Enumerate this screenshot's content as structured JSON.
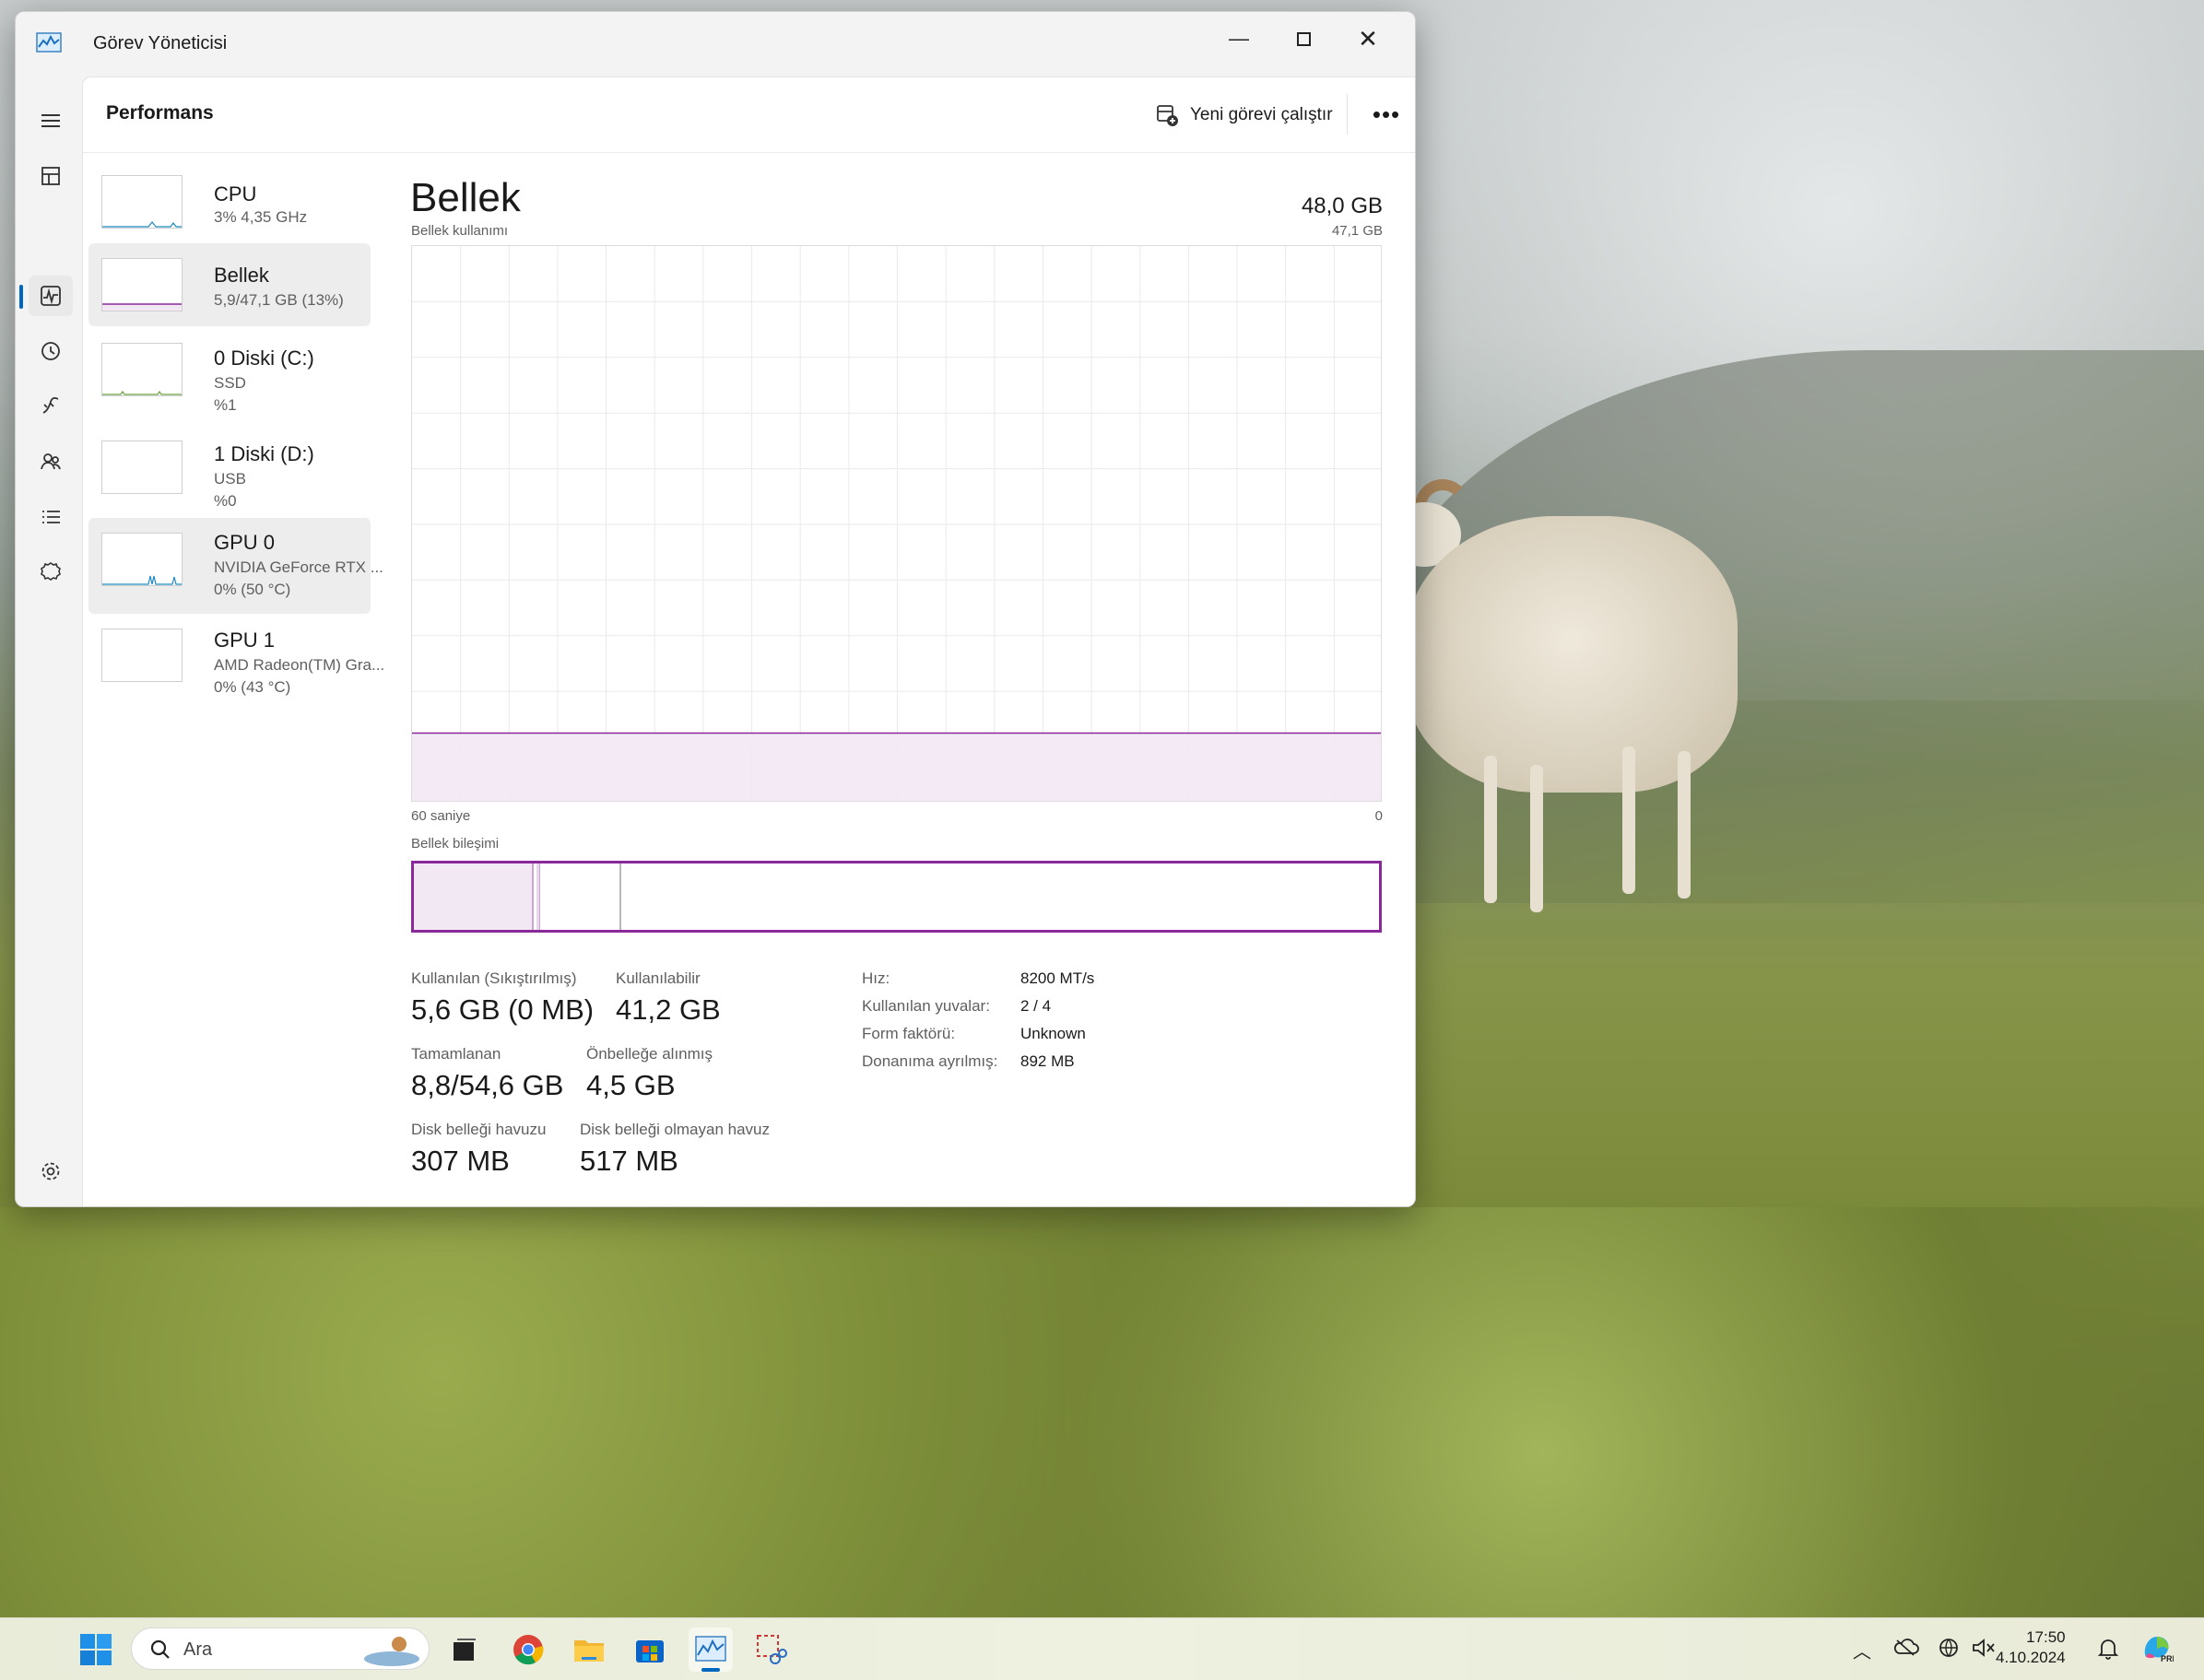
{
  "window": {
    "title": "Görev Yöneticisi"
  },
  "header": {
    "title": "Performans",
    "new_task": "Yeni görevi çalıştır"
  },
  "nav": [
    {
      "name": "menu-icon"
    },
    {
      "name": "processes-icon"
    },
    {
      "name": "performance-icon"
    },
    {
      "name": "app-history-icon"
    },
    {
      "name": "startup-apps-icon"
    },
    {
      "name": "users-icon"
    },
    {
      "name": "details-icon"
    },
    {
      "name": "services-icon"
    },
    {
      "name": "settings-icon"
    }
  ],
  "resources": [
    {
      "name": "CPU",
      "sub1": "3%  4,35 GHz",
      "sub2": ""
    },
    {
      "name": "Bellek",
      "sub1": "5,9/47,1 GB (13%)",
      "sub2": ""
    },
    {
      "name": "0 Diski (C:)",
      "sub1": "SSD",
      "sub2": "%1"
    },
    {
      "name": "1 Diski (D:)",
      "sub1": "USB",
      "sub2": "%0"
    },
    {
      "name": "GPU 0",
      "sub1": "NVIDIA GeForce RTX ...",
      "sub2": "0% (50 °C)"
    },
    {
      "name": "GPU 1",
      "sub1": "AMD Radeon(TM) Gra...",
      "sub2": "0% (43 °C)"
    }
  ],
  "memory": {
    "title": "Bellek",
    "total": "48,0 GB",
    "usage_label": "Bellek kullanımı",
    "max_label": "47,1 GB",
    "time_left": "60 saniye",
    "time_right": "0",
    "usage_fraction": 0.125,
    "composition_label": "Bellek bileşimi",
    "stats": {
      "used_label": "Kullanılan (Sıkıştırılmış)",
      "used_value": "5,6 GB (0 MB)",
      "avail_label": "Kullanılabilir",
      "avail_value": "41,2 GB",
      "committed_label": "Tamamlanan",
      "committed_value": "8,8/54,6 GB",
      "cached_label": "Önbelleğe alınmış",
      "cached_value": "4,5 GB",
      "paged_label": "Disk belleği havuzu",
      "paged_value": "307 MB",
      "nonpaged_label": "Disk belleği olmayan havuz",
      "nonpaged_value": "517 MB"
    },
    "details": [
      {
        "label": "Hız:",
        "value": "8200 MT/s"
      },
      {
        "label": "Kullanılan yuvalar:",
        "value": "2 / 4"
      },
      {
        "label": "Form faktörü:",
        "value": "Unknown"
      },
      {
        "label": "Donanıma ayrılmış:",
        "value": "892 MB"
      }
    ]
  },
  "taskbar": {
    "search_placeholder": "Ara",
    "time": "17:50",
    "date": "4.10.2024",
    "apps": [
      "windows-start-icon",
      "task-view-icon",
      "chrome-icon",
      "file-explorer-icon",
      "store-icon",
      "task-manager-icon",
      "snipping-tool-icon"
    ]
  },
  "colors": {
    "accent": "#0067c0",
    "memory": "#8a2a9a",
    "memory_fill": "#f2e8f4"
  }
}
